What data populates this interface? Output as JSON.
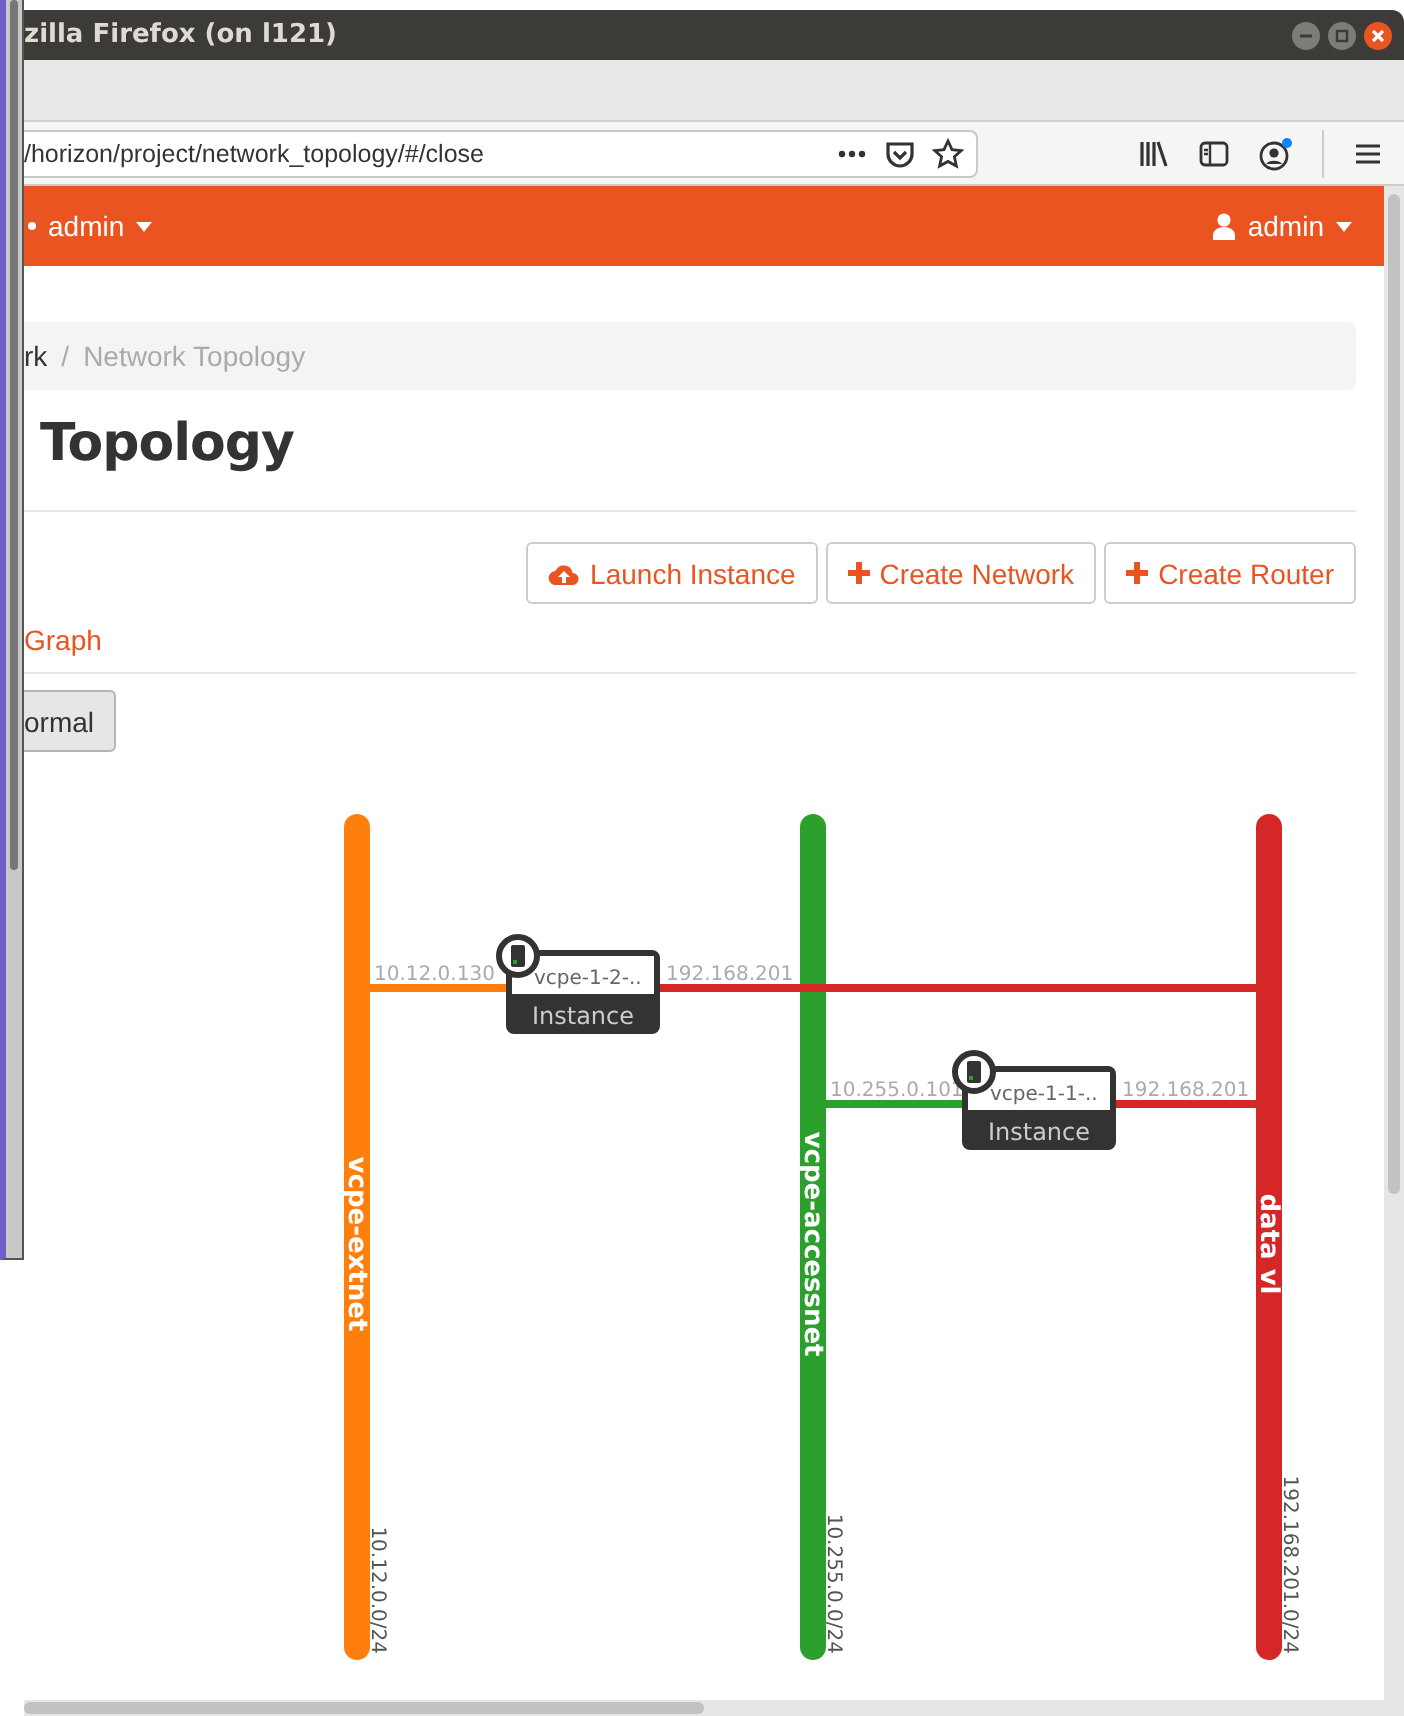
{
  "window": {
    "title": "zilla Firefox (on l121)"
  },
  "address_bar": {
    "url": "/horizon/project/network_topology/#/close"
  },
  "header": {
    "project": "admin",
    "user": "admin"
  },
  "breadcrumb": [
    {
      "label": "rk",
      "current": false
    },
    {
      "label": "Network Topology",
      "current": true
    }
  ],
  "breadcrumb_separator": "/",
  "page_title": "Topology",
  "actions": [
    {
      "label": "Launch Instance",
      "kind": "cloud"
    },
    {
      "label": "Create Network",
      "kind": "plus"
    },
    {
      "label": "Create Router",
      "kind": "plus"
    }
  ],
  "tabs": [
    {
      "label": "Graph",
      "selected": false
    }
  ],
  "toggle_button": "ormal",
  "topology": {
    "networks": [
      {
        "name": "vcpe-extnet",
        "cidr": "10.12.0.0/24",
        "color": "#ff7f0e"
      },
      {
        "name": "vcpe-accessnet",
        "cidr": "10.255.0.0/24",
        "color": "#2ca02c"
      },
      {
        "name": "data vl",
        "cidr": "192.168.201.0/24",
        "color": "#d62728"
      }
    ],
    "instances": [
      {
        "name": "vcpe-1-2-..",
        "type": "Instance",
        "links": [
          {
            "ip": "10.12.0.130"
          },
          {
            "ip": "192.168.201"
          }
        ]
      },
      {
        "name": "vcpe-1-1-..",
        "type": "Instance",
        "links": [
          {
            "ip": "10.255.0.101"
          },
          {
            "ip": "192.168.201"
          }
        ]
      }
    ]
  }
}
